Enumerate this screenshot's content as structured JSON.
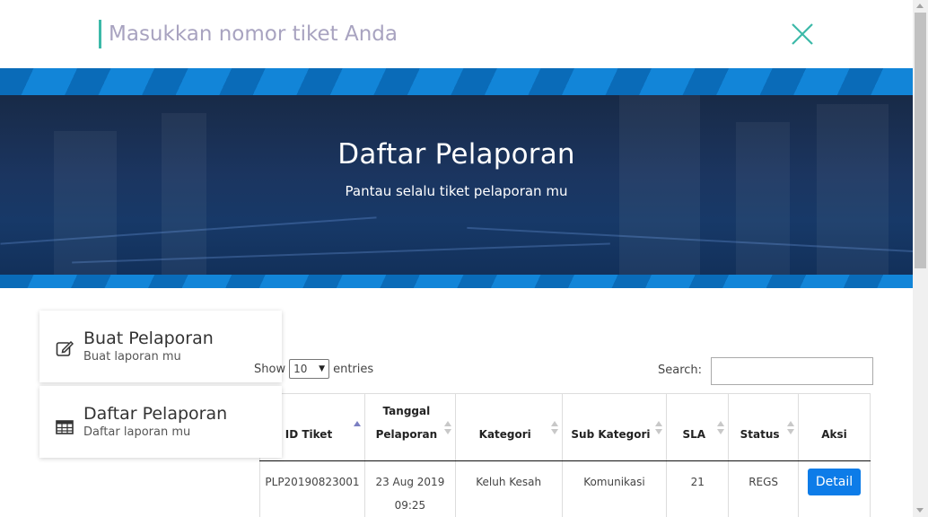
{
  "search": {
    "placeholder": "Masukkan nomor tiket Anda"
  },
  "hero": {
    "title": "Daftar Pelaporan",
    "subtitle": "Pantau selalu tiket pelaporan mu"
  },
  "menu": [
    {
      "title": "Buat Pelaporan",
      "subtitle": "Buat laporan mu",
      "icon": "edit-icon"
    },
    {
      "title": "Daftar Pelaporan",
      "subtitle": "Daftar laporan mu",
      "icon": "table-icon"
    }
  ],
  "controls": {
    "show_label": "Show",
    "entries_value": "10",
    "entries_label": "entries",
    "search_label": "Search:"
  },
  "table": {
    "headers": [
      {
        "line1": "",
        "line2": "ID Tiket",
        "sort": "asc"
      },
      {
        "line1": "Tanggal",
        "line2": "Pelaporan",
        "sort": "none"
      },
      {
        "line1": "",
        "line2": "Kategori",
        "sort": "none"
      },
      {
        "line1": "",
        "line2": "Sub Kategori",
        "sort": "none"
      },
      {
        "line1": "",
        "line2": "SLA",
        "sort": "none"
      },
      {
        "line1": "",
        "line2": "Status",
        "sort": "none"
      },
      {
        "line1": "",
        "line2": "Aksi",
        "sort": ""
      }
    ],
    "rows": [
      {
        "id": "PLP20190823001",
        "date": "23 Aug 2019",
        "time": "09:25",
        "kategori": "Keluh Kesah",
        "sub_kategori": "Komunikasi",
        "sla": "21",
        "status": "REGS",
        "action": "Detail"
      }
    ]
  },
  "colors": {
    "accent": "#3cb9a8",
    "primary": "#0d7ce8",
    "hero_dark": "#182a47",
    "stripe": "#0b74c4"
  }
}
